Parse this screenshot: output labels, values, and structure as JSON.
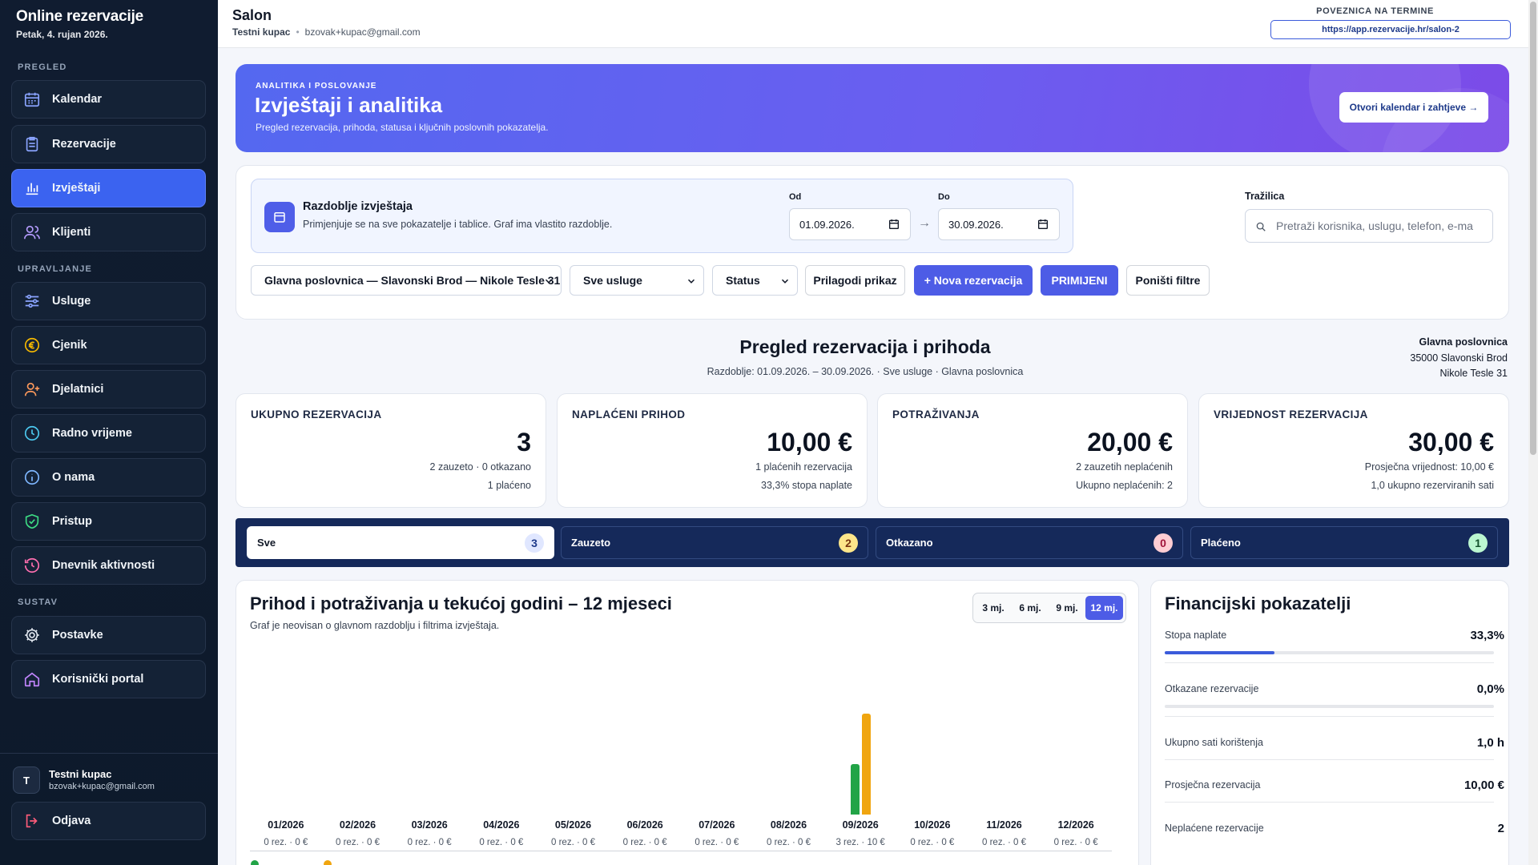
{
  "sidebar": {
    "title": "Online rezervacije",
    "date": "Petak, 4. rujan 2026.",
    "sections": {
      "pregled": "PREGLED",
      "upravljanje": "UPRAVLJANJE",
      "sustav": "SUSTAV"
    },
    "items": [
      {
        "label": "Kalendar",
        "icon": "calendar-icon"
      },
      {
        "label": "Rezervacije",
        "icon": "clipboard-icon"
      },
      {
        "label": "Izvještaji",
        "icon": "bar-chart-icon"
      },
      {
        "label": "Klijenti",
        "icon": "users-icon"
      },
      {
        "label": "Usluge",
        "icon": "sliders-icon"
      },
      {
        "label": "Cjenik",
        "icon": "euro-icon"
      },
      {
        "label": "Djelatnici",
        "icon": "user-plus-icon"
      },
      {
        "label": "Radno vrijeme",
        "icon": "clock-icon"
      },
      {
        "label": "O nama",
        "icon": "info-icon"
      },
      {
        "label": "Pristup",
        "icon": "shield-icon"
      },
      {
        "label": "Dnevnik aktivnosti",
        "icon": "history-icon"
      },
      {
        "label": "Postavke",
        "icon": "gear-icon"
      },
      {
        "label": "Korisnički portal",
        "icon": "home-icon"
      }
    ],
    "active_item": "Izvještaji",
    "user": {
      "initial": "T",
      "name": "Testni kupac",
      "email": "bzovak+kupac@gmail.com"
    },
    "logout": "Odjava"
  },
  "topbar": {
    "title": "Salon",
    "user": "Testni kupac",
    "email": "bzovak+kupac@gmail.com",
    "link_label": "POVEZNICA NA TERMINE",
    "link": "https://app.rezervacije.hr/salon-2"
  },
  "hero": {
    "kicker": "ANALITIKA I POSLOVANJE",
    "title": "Izvještaji i analitika",
    "subtitle": "Pregled rezervacija, prihoda, statusa i ključnih poslovnih pokazatelja.",
    "button": "Otvori kalendar i zahtjeve →"
  },
  "filters": {
    "period_title": "Razdoblje izvještaja",
    "period_sub": "Primjenjuje se na sve pokazatelje i tablice. Graf ima vlastito razdoblje.",
    "from_label": "Od",
    "from_value": "01.09.2026.",
    "to_label": "Do",
    "to_value": "30.09.2026.",
    "arrow": "→",
    "search_label": "Tražilica",
    "search_placeholder": "Pretraži korisnika, uslugu, telefon, e-ma",
    "branch": "Glavna poslovnica — Slavonski Brod — Nikole Tesle 31",
    "services": "Sve usluge",
    "status": "Status",
    "customize": "Prilagodi prikaz",
    "new_reservation": "+ Nova rezervacija",
    "apply": "PRIMIJENI",
    "reset": "Poništi filtre"
  },
  "overview": {
    "title": "Pregled rezervacija i prihoda",
    "subtitle": "Razdoblje: 01.09.2026. – 30.09.2026. · Sve usluge · Glavna poslovnica",
    "address": {
      "name": "Glavna poslovnica",
      "city": "35000 Slavonski Brod",
      "street": "Nikole Tesle 31"
    }
  },
  "kpis": [
    {
      "title": "UKUPNO REZERVACIJA",
      "value": "3",
      "line1": "2 zauzeto · 0 otkazano",
      "line2": "1 plaćeno"
    },
    {
      "title": "NAPLAĆENI PRIHOD",
      "value": "10,00 €",
      "line1": "1 plaćenih rezervacija",
      "line2": "33,3% stopa naplate"
    },
    {
      "title": "POTRAŽIVANJA",
      "value": "20,00 €",
      "line1": "2 zauzetih neplaćenih",
      "line2": "Ukupno neplaćenih: 2"
    },
    {
      "title": "VRIJEDNOST REZERVACIJA",
      "value": "30,00 €",
      "line1": "Prosječna vrijednost: 10,00 €",
      "line2": "1,0 ukupno rezerviranih sati"
    }
  ],
  "status_tabs": [
    {
      "label": "Sve",
      "count": "3",
      "color": "#e0e7ff",
      "text": "#1e3a8a"
    },
    {
      "label": "Zauzeto",
      "count": "2",
      "color": "#fde68a",
      "text": "#78350f"
    },
    {
      "label": "Otkazano",
      "count": "0",
      "color": "#fecdd3",
      "text": "#9f1239"
    },
    {
      "label": "Plaćeno",
      "count": "1",
      "color": "#bbf7d0",
      "text": "#14532d"
    }
  ],
  "chart_card": {
    "title": "Prihod i potraživanja u tekućoj godini – 12 mjeseci",
    "subtitle": "Graf je neovisan o glavnom razdoblju i filtrima izvještaja.",
    "ranges": [
      "3 mj.",
      "6 mj.",
      "9 mj.",
      "12 mj."
    ],
    "active_range": "12 mj."
  },
  "chart_data": {
    "type": "bar",
    "categories": [
      "01/2026",
      "02/2026",
      "03/2026",
      "04/2026",
      "05/2026",
      "06/2026",
      "07/2026",
      "08/2026",
      "09/2026",
      "10/2026",
      "11/2026",
      "12/2026"
    ],
    "category_sublabels": [
      "0 rez. · 0 €",
      "0 rez. · 0 €",
      "0 rez. · 0 €",
      "0 rez. · 0 €",
      "0 rez. · 0 €",
      "0 rez. · 0 €",
      "0 rez. · 0 €",
      "0 rez. · 0 €",
      "3 rez. · 10 €",
      "0 rez. · 0 €",
      "0 rez. · 0 €",
      "0 rez. · 0 €"
    ],
    "series": [
      {
        "values": [
          0,
          0,
          0,
          0,
          0,
          0,
          0,
          0,
          10,
          0,
          0,
          0
        ],
        "color": "#22a447"
      },
      {
        "values": [
          0,
          0,
          0,
          0,
          0,
          0,
          0,
          0,
          20,
          0,
          0,
          0
        ],
        "color": "#f0a50f"
      }
    ],
    "ylim": [
      0,
      20
    ]
  },
  "financial": {
    "title": "Financijski pokazatelji",
    "rows": [
      {
        "label": "Stopa naplate",
        "value": "33,3%",
        "fill": 0.333
      },
      {
        "label": "Otkazane rezervacije",
        "value": "0,0%",
        "fill": 0
      },
      {
        "label": "Ukupno sati korištenja",
        "value": "1,0 h"
      },
      {
        "label": "Prosječna rezervacija",
        "value": "10,00 €"
      },
      {
        "label": "Neplaćene rezervacije",
        "value": "2"
      }
    ]
  }
}
